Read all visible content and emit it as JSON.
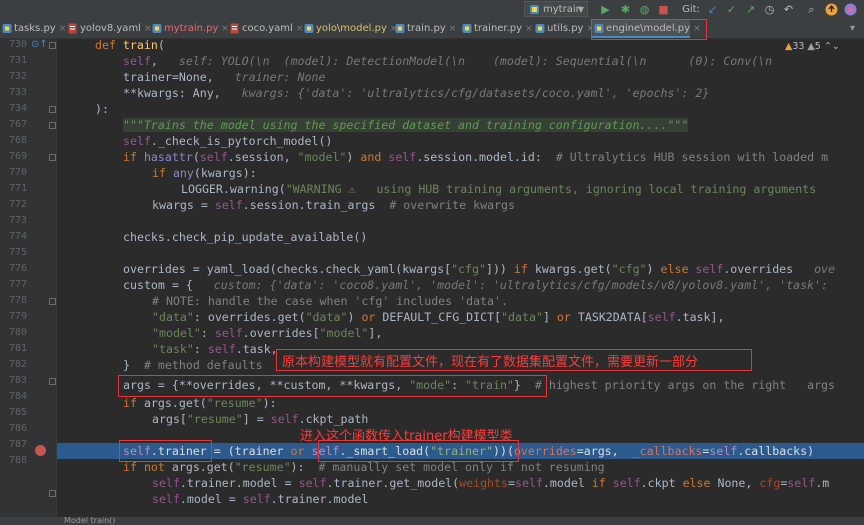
{
  "toolbar": {
    "run_config": "mytrain",
    "git_label": "Git:"
  },
  "tabs": [
    {
      "label": "tasks.py",
      "color": "#bbbbbb"
    },
    {
      "label": "yolov8.yaml",
      "color": "#bbbbbb"
    },
    {
      "label": "mytrain.py",
      "color": "#e06c75"
    },
    {
      "label": "coco.yaml",
      "color": "#bbbbbb"
    },
    {
      "label": "yolo\\model.py",
      "color": "#d6c26a"
    },
    {
      "label": "train.py",
      "color": "#bbbbbb"
    },
    {
      "label": "trainer.py",
      "color": "#bbbbbb"
    },
    {
      "label": "utils.py",
      "color": "#bbbbbb"
    },
    {
      "label": "engine\\model.py",
      "color": "#bbbbbb"
    }
  ],
  "inspection": {
    "warnings": "33",
    "weak": "5"
  },
  "line_numbers": [
    "730",
    "731",
    "732",
    "733",
    "734",
    "767",
    "768",
    "769",
    "770",
    "771",
    "772",
    "773",
    "774",
    "775",
    "776",
    "777",
    "778",
    "779",
    "780",
    "781",
    "782",
    "783",
    "784",
    "785",
    "786",
    "787",
    "788"
  ],
  "code": {
    "l730": {
      "def": "def ",
      "name": "train",
      "paren": "("
    },
    "l731": {
      "self": "self",
      "rest": ",   ",
      "hint": "self: YOLO(\\n  (model): DetectionModel(\\n    (model): Sequential(\\n      (0): Conv(\\n"
    },
    "l732": {
      "code": "trainer=None,   ",
      "hint": "trainer: None"
    },
    "l733": {
      "code": "**kwargs: Any,   ",
      "hint": "kwargs: {'data': 'ultralytics/cfg/datasets/coco.yaml', 'epochs': 2}"
    },
    "l734": {
      "code": "):"
    },
    "l767": {
      "doc": "\"\"\"Trains the model using the specified dataset and training configuration....\"\"\""
    },
    "l768": {
      "self": "self",
      "code": "._check_is_pytorch_model()"
    },
    "l769": {
      "kw1": "if ",
      "builtin": "hasattr",
      "p1": "(",
      "self": "self",
      "p2": ".session, ",
      "str": "\"model\"",
      "p3": ") ",
      "kw2": "and ",
      "self2": "self",
      "p4": ".session.model.id:  ",
      "cm": "# Ultralytics HUB session with loaded m"
    },
    "l770": {
      "kw": "if ",
      "builtin": "any",
      "code": "(kwargs):"
    },
    "l771": {
      "code": "LOGGER.warning(",
      "str": "\"WARNING ⚠   using HUB training arguments, ignoring local training arguments"
    },
    "l772": {
      "code": "kwargs = ",
      "self": "self",
      "code2": ".session.train_args  ",
      "cm": "# overwrite kwargs"
    },
    "l774": {
      "code": "checks.check_pip_update_available()"
    },
    "l776": {
      "code": "overrides = yaml_load(checks.check_yaml(kwargs[",
      "str": "\"cfg\"",
      "code2": "])) ",
      "kw1": "if ",
      "code3": "kwargs.get(",
      "str2": "\"cfg\"",
      "code4": ") ",
      "kw2": "else ",
      "self": "self",
      "code5": ".overrides   ",
      "hint": "ove"
    },
    "l777": {
      "code": "custom = {   ",
      "hint": "custom: {'data': 'coco8.yaml', 'model': 'ultralytics/cfg/models/v8/yolov8.yaml', 'task':"
    },
    "l778": {
      "cm": "# NOTE: handle the case when 'cfg' includes 'data'."
    },
    "l779": {
      "str": "\"data\"",
      "code": ": overrides.get(",
      "str2": "\"data\"",
      "code2": ") ",
      "kw": "or ",
      "code3": "DEFAULT_CFG_DICT[",
      "str3": "\"data\"",
      "code4": "] ",
      "kw2": "or ",
      "code5": "TASK2DATA[",
      "self": "self",
      "code6": ".task],"
    },
    "l780": {
      "str": "\"model\"",
      "code": ": ",
      "self": "self",
      "code2": ".overrides[",
      "str2": "\"model\"",
      "code3": "],"
    },
    "l781": {
      "str": "\"task\"",
      "code": ": ",
      "self": "self",
      "code2": ".task,"
    },
    "l782": {
      "code": "}  ",
      "cm": "# method defaults"
    },
    "l783": {
      "code": "args = {**overrides, **custom, **kwargs, ",
      "str": "\"mode\"",
      "code2": ": ",
      "str2": "\"train\"",
      "code3": "}  ",
      "cm": "# highest priority args on the right   args"
    },
    "l784": {
      "kw": "if ",
      "code": "args.get(",
      "str": "\"resume\"",
      "code2": "):"
    },
    "l785": {
      "code": "args[",
      "str": "\"resume\"",
      "code2": "] = ",
      "self": "self",
      "code3": ".ckpt_path"
    },
    "l786": {
      "self": "self",
      "code": ".trainer = (trainer ",
      "kw": "or ",
      "self2": "self",
      "code2": "._smart_load(",
      "str": "\"trainer\"",
      "code3": "))(",
      "param": "overrides",
      "code4": "=args,  ",
      "param2": "_callbacks",
      "code5": "=",
      "self3": "self",
      "code6": ".callbacks)"
    },
    "l787": {
      "kw": "if not ",
      "code": "args.get(",
      "str": "\"resume\"",
      "code2": "):  ",
      "cm": "# manually set model only if not resuming"
    },
    "l788": {
      "self": "self",
      "code": ".trainer.model = ",
      "self2": "self",
      "code2": ".trainer.get_model(",
      "param": "weights",
      "code3": "=",
      "self3": "self",
      "code4": ".model ",
      "kw": "if ",
      "self4": "self",
      "code5": ".ckpt ",
      "kw2": "else ",
      "code6": "None, ",
      "param2": "cfg",
      "code7": "=",
      "self5": "self",
      "code8": ".m"
    },
    "l789": {
      "self": "self",
      "code": ".model = ",
      "self2": "self",
      "code2": ".trainer.model"
    }
  },
  "annotations": {
    "a1": "原本构建模型就有配置文件，现在有了数据集配置文件，需要更新一部分",
    "a2": "进入这个函数传入trainer构建模型类"
  },
  "status": {
    "text": "Model    train()"
  },
  "colors": {
    "highlight": "#2d5a8c",
    "annotation": "#ff3b3b",
    "breakpoint": "#c75450"
  }
}
